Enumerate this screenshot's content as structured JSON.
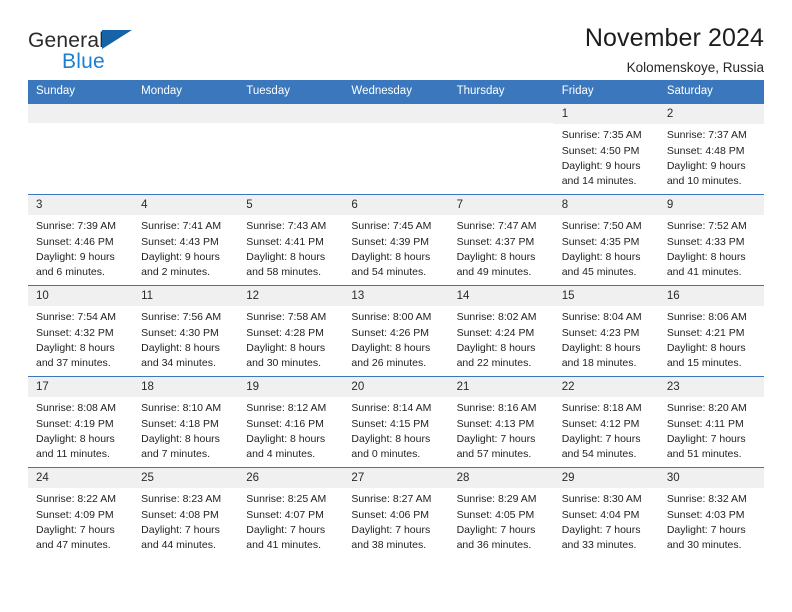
{
  "brand": {
    "name_top": "General",
    "name_bottom": "Blue",
    "triangle_color": "#1763a8",
    "blue_color": "#1b7fd4"
  },
  "header": {
    "title": "November 2024",
    "subtitle": "Kolomenskoye, Russia"
  },
  "theme": {
    "header_bg": "#3a77bd",
    "header_text": "#ffffff",
    "daynum_bg": "#f0f0f0",
    "cell_bg": "#ffffff",
    "rule_color": "#3a77bd"
  },
  "calendar": {
    "weekday_headers": [
      "Sunday",
      "Monday",
      "Tuesday",
      "Wednesday",
      "Thursday",
      "Friday",
      "Saturday"
    ],
    "labels": {
      "sunrise": "Sunrise:",
      "sunset": "Sunset:",
      "daylight": "Daylight:"
    },
    "weeks": [
      [
        {
          "blank": true,
          "day": ""
        },
        {
          "blank": true,
          "day": ""
        },
        {
          "blank": true,
          "day": ""
        },
        {
          "blank": true,
          "day": ""
        },
        {
          "blank": true,
          "day": ""
        },
        {
          "blank": false,
          "day": "1",
          "sunrise": "Sunrise: 7:35 AM",
          "sunset": "Sunset: 4:50 PM",
          "daylight_1": "Daylight: 9 hours",
          "daylight_2": "and 14 minutes."
        },
        {
          "blank": false,
          "day": "2",
          "sunrise": "Sunrise: 7:37 AM",
          "sunset": "Sunset: 4:48 PM",
          "daylight_1": "Daylight: 9 hours",
          "daylight_2": "and 10 minutes."
        }
      ],
      [
        {
          "blank": false,
          "day": "3",
          "sunrise": "Sunrise: 7:39 AM",
          "sunset": "Sunset: 4:46 PM",
          "daylight_1": "Daylight: 9 hours",
          "daylight_2": "and 6 minutes."
        },
        {
          "blank": false,
          "day": "4",
          "sunrise": "Sunrise: 7:41 AM",
          "sunset": "Sunset: 4:43 PM",
          "daylight_1": "Daylight: 9 hours",
          "daylight_2": "and 2 minutes."
        },
        {
          "blank": false,
          "day": "5",
          "sunrise": "Sunrise: 7:43 AM",
          "sunset": "Sunset: 4:41 PM",
          "daylight_1": "Daylight: 8 hours",
          "daylight_2": "and 58 minutes."
        },
        {
          "blank": false,
          "day": "6",
          "sunrise": "Sunrise: 7:45 AM",
          "sunset": "Sunset: 4:39 PM",
          "daylight_1": "Daylight: 8 hours",
          "daylight_2": "and 54 minutes."
        },
        {
          "blank": false,
          "day": "7",
          "sunrise": "Sunrise: 7:47 AM",
          "sunset": "Sunset: 4:37 PM",
          "daylight_1": "Daylight: 8 hours",
          "daylight_2": "and 49 minutes."
        },
        {
          "blank": false,
          "day": "8",
          "sunrise": "Sunrise: 7:50 AM",
          "sunset": "Sunset: 4:35 PM",
          "daylight_1": "Daylight: 8 hours",
          "daylight_2": "and 45 minutes."
        },
        {
          "blank": false,
          "day": "9",
          "sunrise": "Sunrise: 7:52 AM",
          "sunset": "Sunset: 4:33 PM",
          "daylight_1": "Daylight: 8 hours",
          "daylight_2": "and 41 minutes."
        }
      ],
      [
        {
          "blank": false,
          "day": "10",
          "sunrise": "Sunrise: 7:54 AM",
          "sunset": "Sunset: 4:32 PM",
          "daylight_1": "Daylight: 8 hours",
          "daylight_2": "and 37 minutes."
        },
        {
          "blank": false,
          "day": "11",
          "sunrise": "Sunrise: 7:56 AM",
          "sunset": "Sunset: 4:30 PM",
          "daylight_1": "Daylight: 8 hours",
          "daylight_2": "and 34 minutes."
        },
        {
          "blank": false,
          "day": "12",
          "sunrise": "Sunrise: 7:58 AM",
          "sunset": "Sunset: 4:28 PM",
          "daylight_1": "Daylight: 8 hours",
          "daylight_2": "and 30 minutes."
        },
        {
          "blank": false,
          "day": "13",
          "sunrise": "Sunrise: 8:00 AM",
          "sunset": "Sunset: 4:26 PM",
          "daylight_1": "Daylight: 8 hours",
          "daylight_2": "and 26 minutes."
        },
        {
          "blank": false,
          "day": "14",
          "sunrise": "Sunrise: 8:02 AM",
          "sunset": "Sunset: 4:24 PM",
          "daylight_1": "Daylight: 8 hours",
          "daylight_2": "and 22 minutes."
        },
        {
          "blank": false,
          "day": "15",
          "sunrise": "Sunrise: 8:04 AM",
          "sunset": "Sunset: 4:23 PM",
          "daylight_1": "Daylight: 8 hours",
          "daylight_2": "and 18 minutes."
        },
        {
          "blank": false,
          "day": "16",
          "sunrise": "Sunrise: 8:06 AM",
          "sunset": "Sunset: 4:21 PM",
          "daylight_1": "Daylight: 8 hours",
          "daylight_2": "and 15 minutes."
        }
      ],
      [
        {
          "blank": false,
          "day": "17",
          "sunrise": "Sunrise: 8:08 AM",
          "sunset": "Sunset: 4:19 PM",
          "daylight_1": "Daylight: 8 hours",
          "daylight_2": "and 11 minutes."
        },
        {
          "blank": false,
          "day": "18",
          "sunrise": "Sunrise: 8:10 AM",
          "sunset": "Sunset: 4:18 PM",
          "daylight_1": "Daylight: 8 hours",
          "daylight_2": "and 7 minutes."
        },
        {
          "blank": false,
          "day": "19",
          "sunrise": "Sunrise: 8:12 AM",
          "sunset": "Sunset: 4:16 PM",
          "daylight_1": "Daylight: 8 hours",
          "daylight_2": "and 4 minutes."
        },
        {
          "blank": false,
          "day": "20",
          "sunrise": "Sunrise: 8:14 AM",
          "sunset": "Sunset: 4:15 PM",
          "daylight_1": "Daylight: 8 hours",
          "daylight_2": "and 0 minutes."
        },
        {
          "blank": false,
          "day": "21",
          "sunrise": "Sunrise: 8:16 AM",
          "sunset": "Sunset: 4:13 PM",
          "daylight_1": "Daylight: 7 hours",
          "daylight_2": "and 57 minutes."
        },
        {
          "blank": false,
          "day": "22",
          "sunrise": "Sunrise: 8:18 AM",
          "sunset": "Sunset: 4:12 PM",
          "daylight_1": "Daylight: 7 hours",
          "daylight_2": "and 54 minutes."
        },
        {
          "blank": false,
          "day": "23",
          "sunrise": "Sunrise: 8:20 AM",
          "sunset": "Sunset: 4:11 PM",
          "daylight_1": "Daylight: 7 hours",
          "daylight_2": "and 51 minutes."
        }
      ],
      [
        {
          "blank": false,
          "day": "24",
          "sunrise": "Sunrise: 8:22 AM",
          "sunset": "Sunset: 4:09 PM",
          "daylight_1": "Daylight: 7 hours",
          "daylight_2": "and 47 minutes."
        },
        {
          "blank": false,
          "day": "25",
          "sunrise": "Sunrise: 8:23 AM",
          "sunset": "Sunset: 4:08 PM",
          "daylight_1": "Daylight: 7 hours",
          "daylight_2": "and 44 minutes."
        },
        {
          "blank": false,
          "day": "26",
          "sunrise": "Sunrise: 8:25 AM",
          "sunset": "Sunset: 4:07 PM",
          "daylight_1": "Daylight: 7 hours",
          "daylight_2": "and 41 minutes."
        },
        {
          "blank": false,
          "day": "27",
          "sunrise": "Sunrise: 8:27 AM",
          "sunset": "Sunset: 4:06 PM",
          "daylight_1": "Daylight: 7 hours",
          "daylight_2": "and 38 minutes."
        },
        {
          "blank": false,
          "day": "28",
          "sunrise": "Sunrise: 8:29 AM",
          "sunset": "Sunset: 4:05 PM",
          "daylight_1": "Daylight: 7 hours",
          "daylight_2": "and 36 minutes."
        },
        {
          "blank": false,
          "day": "29",
          "sunrise": "Sunrise: 8:30 AM",
          "sunset": "Sunset: 4:04 PM",
          "daylight_1": "Daylight: 7 hours",
          "daylight_2": "and 33 minutes."
        },
        {
          "blank": false,
          "day": "30",
          "sunrise": "Sunrise: 8:32 AM",
          "sunset": "Sunset: 4:03 PM",
          "daylight_1": "Daylight: 7 hours",
          "daylight_2": "and 30 minutes."
        }
      ]
    ]
  }
}
